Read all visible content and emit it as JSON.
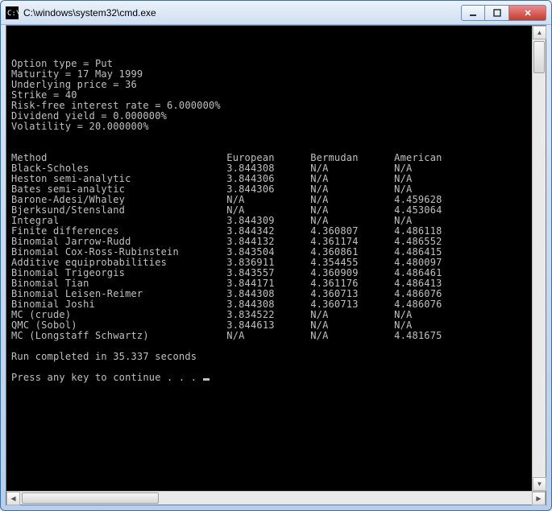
{
  "window": {
    "title": "C:\\windows\\system32\\cmd.exe"
  },
  "option": {
    "type_line": "Option type = Put",
    "maturity_line": "Maturity = 17 May 1999",
    "underlying_line": "Underlying price = 36",
    "strike_line": "Strike = 40",
    "rate_line": "Risk-free interest rate = 6.000000%",
    "dividend_line": "Dividend yield = 0.000000%",
    "volatility_line": "Volatility = 20.000000%",
    "values": {
      "type": "Put",
      "maturity": "17 May 1999",
      "underlying_price": 36,
      "strike": 40,
      "risk_free_rate_pct": 6.0,
      "dividend_yield_pct": 0.0,
      "volatility_pct": 20.0
    }
  },
  "table": {
    "headers": {
      "method": "Method",
      "european": "European",
      "bermudan": "Bermudan",
      "american": "American"
    },
    "rows": [
      {
        "method": "Black-Scholes",
        "european": "3.844308",
        "bermudan": "N/A",
        "american": "N/A"
      },
      {
        "method": "Heston semi-analytic",
        "european": "3.844306",
        "bermudan": "N/A",
        "american": "N/A"
      },
      {
        "method": "Bates semi-analytic",
        "european": "3.844306",
        "bermudan": "N/A",
        "american": "N/A"
      },
      {
        "method": "Barone-Adesi/Whaley",
        "european": "N/A",
        "bermudan": "N/A",
        "american": "4.459628"
      },
      {
        "method": "Bjerksund/Stensland",
        "european": "N/A",
        "bermudan": "N/A",
        "american": "4.453064"
      },
      {
        "method": "Integral",
        "european": "3.844309",
        "bermudan": "N/A",
        "american": "N/A"
      },
      {
        "method": "Finite differences",
        "european": "3.844342",
        "bermudan": "4.360807",
        "american": "4.486118"
      },
      {
        "method": "Binomial Jarrow-Rudd",
        "european": "3.844132",
        "bermudan": "4.361174",
        "american": "4.486552"
      },
      {
        "method": "Binomial Cox-Ross-Rubinstein",
        "european": "3.843504",
        "bermudan": "4.360861",
        "american": "4.486415"
      },
      {
        "method": "Additive equiprobabilities",
        "european": "3.836911",
        "bermudan": "4.354455",
        "american": "4.480097"
      },
      {
        "method": "Binomial Trigeorgis",
        "european": "3.843557",
        "bermudan": "4.360909",
        "american": "4.486461"
      },
      {
        "method": "Binomial Tian",
        "european": "3.844171",
        "bermudan": "4.361176",
        "american": "4.486413"
      },
      {
        "method": "Binomial Leisen-Reimer",
        "european": "3.844308",
        "bermudan": "4.360713",
        "american": "4.486076"
      },
      {
        "method": "Binomial Joshi",
        "european": "3.844308",
        "bermudan": "4.360713",
        "american": "4.486076"
      },
      {
        "method": "MC (crude)",
        "european": "3.834522",
        "bermudan": "N/A",
        "american": "N/A"
      },
      {
        "method": "QMC (Sobol)",
        "european": "3.844613",
        "bermudan": "N/A",
        "american": "N/A"
      },
      {
        "method": "MC (Longstaff Schwartz)",
        "european": "N/A",
        "bermudan": "N/A",
        "american": "4.481675"
      }
    ]
  },
  "footer": {
    "run_line": "Run completed in 35.337 seconds",
    "run_seconds": 35.337,
    "prompt": "Press any key to continue . . . "
  },
  "chart_data": {
    "type": "table",
    "title": "Option pricing method comparison",
    "columns": [
      "Method",
      "European",
      "Bermudan",
      "American"
    ],
    "rows": [
      [
        "Black-Scholes",
        3.844308,
        null,
        null
      ],
      [
        "Heston semi-analytic",
        3.844306,
        null,
        null
      ],
      [
        "Bates semi-analytic",
        3.844306,
        null,
        null
      ],
      [
        "Barone-Adesi/Whaley",
        null,
        null,
        4.459628
      ],
      [
        "Bjerksund/Stensland",
        null,
        null,
        4.453064
      ],
      [
        "Integral",
        3.844309,
        null,
        null
      ],
      [
        "Finite differences",
        3.844342,
        4.360807,
        4.486118
      ],
      [
        "Binomial Jarrow-Rudd",
        3.844132,
        4.361174,
        4.486552
      ],
      [
        "Binomial Cox-Ross-Rubinstein",
        3.843504,
        4.360861,
        4.486415
      ],
      [
        "Additive equiprobabilities",
        3.836911,
        4.354455,
        4.480097
      ],
      [
        "Binomial Trigeorgis",
        3.843557,
        4.360909,
        4.486461
      ],
      [
        "Binomial Tian",
        3.844171,
        4.361176,
        4.486413
      ],
      [
        "Binomial Leisen-Reimer",
        3.844308,
        4.360713,
        4.486076
      ],
      [
        "Binomial Joshi",
        3.844308,
        4.360713,
        4.486076
      ],
      [
        "MC (crude)",
        3.834522,
        null,
        null
      ],
      [
        "QMC (Sobol)",
        3.844613,
        null,
        null
      ],
      [
        "MC (Longstaff Schwartz)",
        null,
        null,
        4.481675
      ]
    ]
  }
}
